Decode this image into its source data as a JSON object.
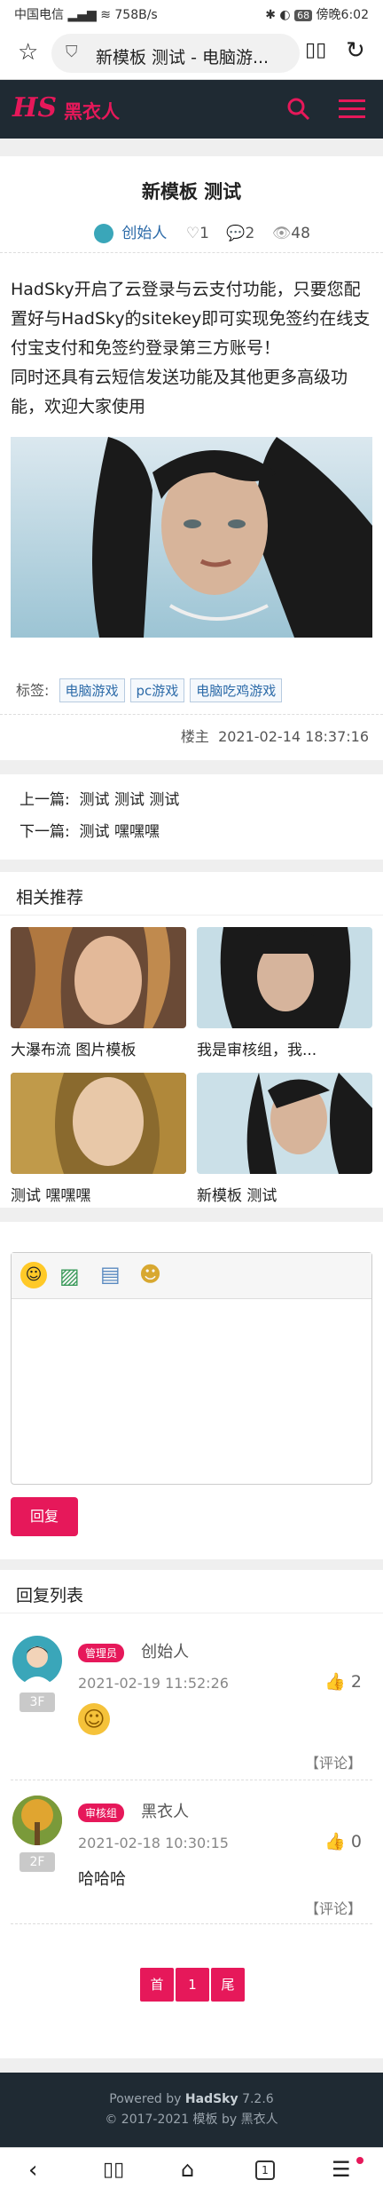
{
  "status_bar": {
    "carrier": "中国电信",
    "speed": "758B/s",
    "battery": "68",
    "time": "傍晚6:02"
  },
  "browser": {
    "url_title": "新模板 测试 - 电脑游...",
    "tab_count": "1"
  },
  "site": {
    "logo": "HS",
    "name": "黑衣人"
  },
  "post": {
    "title": "新模板 测试",
    "author": "创始人",
    "likes": "1",
    "comments": "2",
    "views": "48",
    "body": [
      "HadSky开启了云登录与云支付功能，只要您配置好与HadSky的sitekey即可实现免签约在线支付宝支付和免签约登录第三方账号！",
      "同时还具有云短信发送功能及其他更多高级功能，欢迎大家使用"
    ],
    "tags_label": "标签:",
    "tags": [
      "电脑游戏",
      "pc游戏",
      "电脑吃鸡游戏"
    ],
    "owner_label": "楼主",
    "date": "2021-02-14 18:37:16"
  },
  "pager": {
    "prev_label": "上一篇:",
    "prev": "测试 测试 测试",
    "next_label": "下一篇:",
    "next": "测试 嘿嘿嘿"
  },
  "related": {
    "title": "相关推荐",
    "items": [
      {
        "caption": "大瀑布流 图片模板"
      },
      {
        "caption": "我是审核组，我..."
      },
      {
        "caption": "测试 嘿嘿嘿"
      },
      {
        "caption": "新模板 测试"
      }
    ]
  },
  "reply_form": {
    "submit": "回复"
  },
  "replies": {
    "title": "回复列表",
    "items": [
      {
        "badge": "管理员",
        "user": "创始人",
        "floor": "3F",
        "time": "2021-02-19 11:52:26",
        "likes": "2",
        "content": "",
        "comment": "【评论】"
      },
      {
        "badge": "审核组",
        "user": "黑衣人",
        "floor": "2F",
        "time": "2021-02-18 10:30:15",
        "likes": "0",
        "content": "哈哈哈",
        "comment": "【评论】"
      }
    ]
  },
  "pagination": {
    "first": "首",
    "current": "1",
    "last": "尾"
  },
  "footer": {
    "powered": "Powered by",
    "brand": "HadSky",
    "version": "7.2.6",
    "copyright": "© 2017-2021 模板 by 黑衣人"
  },
  "colors": {
    "accent": "#e6185a",
    "nav": "#1f2a33"
  }
}
